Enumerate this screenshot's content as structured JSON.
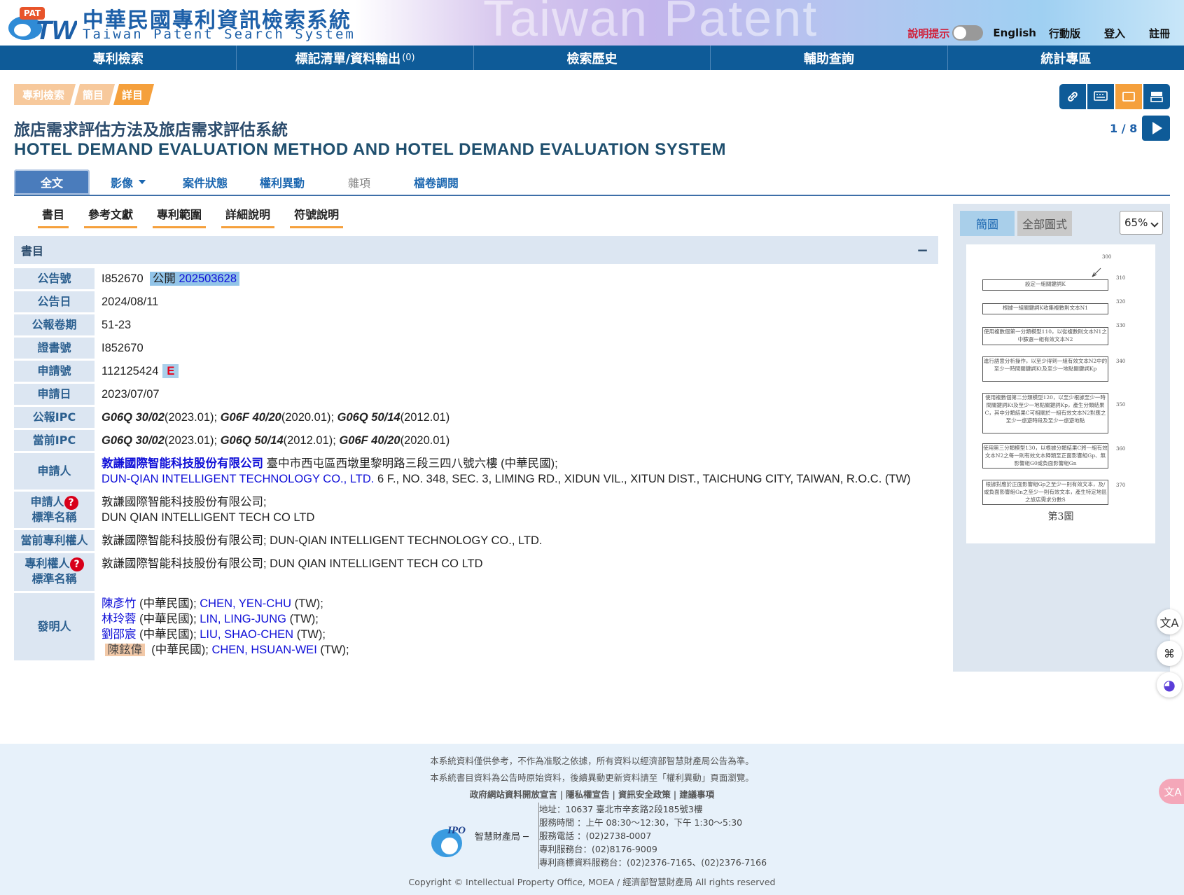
{
  "header": {
    "site_title_zh": "中華民國專利資訊檢索系統",
    "site_title_en": "Taiwan Patent Search System",
    "logo_text": "PAT",
    "logo_letters": "TW",
    "watermark": "Taiwan Patent",
    "hint_label": "說明提示",
    "links": [
      "English",
      "行動版",
      "登入",
      "註冊"
    ]
  },
  "nav": {
    "items": [
      "專利檢索",
      "標記清單/資料輸出",
      "檢索歷史",
      "輔助查詢",
      "統計專區"
    ],
    "marked_count": "(0)"
  },
  "breadcrumb": [
    "專利檢索",
    "簡目",
    "詳目"
  ],
  "pager": "1 / 8",
  "title_zh": "旅店需求評估方法及旅店需求評估系統",
  "title_en": "HOTEL DEMAND EVALUATION METHOD AND HOTEL DEMAND EVALUATION SYSTEM",
  "tabs": [
    "全文",
    "影像",
    "案件狀態",
    "權利異動",
    "雜項",
    "檔卷調閱"
  ],
  "subtabs": [
    "書目",
    "參考文獻",
    "專利範圍",
    "詳細說明",
    "符號說明"
  ],
  "section_title": "書目",
  "section_toggle": "−",
  "biblio": {
    "labels": {
      "pub_no": "公告號",
      "pub_date": "公告日",
      "gazette": "公報卷期",
      "cert_no": "證書號",
      "app_no": "申請號",
      "app_date": "申請日",
      "gazette_ipc": "公報IPC",
      "current_ipc": "當前IPC",
      "applicant": "申請人",
      "applicant_std_1": "申請人",
      "applicant_std_2": "標準名稱",
      "current_owner": "當前專利權人",
      "owner_std_1": "專利權人",
      "owner_std_2": "標準名稱",
      "inventor": "發明人"
    },
    "pub_no": "I852670",
    "pub_open_label": "公開",
    "pub_open_no": "202503628",
    "pub_date": "2024/08/11",
    "gazette": "51-23",
    "cert_no": "I852670",
    "app_no": "112125424",
    "app_badge": "E",
    "app_date": "2023/07/07",
    "gazette_ipc": [
      {
        "code": "G06Q 30/02",
        "ver": "(2023.01)"
      },
      {
        "code": "G06F 40/20",
        "ver": "(2020.01)"
      },
      {
        "code": "G06Q 50/14",
        "ver": "(2012.01)"
      }
    ],
    "current_ipc": [
      {
        "code": "G06Q 30/02",
        "ver": "(2023.01)"
      },
      {
        "code": "G06Q 50/14",
        "ver": "(2012.01)"
      },
      {
        "code": "G06F 40/20",
        "ver": "(2020.01)"
      }
    ],
    "applicant_zh": "敦謙國際智能科技股份有限公司",
    "applicant_zh_addr": "臺中市西屯區西墩里黎明路三段三四八號六樓 (中華民國);",
    "applicant_en": "DUN-QIAN INTELLIGENT TECHNOLOGY CO., LTD.",
    "applicant_en_addr": "6 F., NO. 348, SEC. 3, LIMING RD., XIDUN VIL., XITUN DIST., TAICHUNG CITY, TAIWAN, R.O.C. (TW)",
    "applicant_std_zh": "敦謙國際智能科技股份有限公司;",
    "applicant_std_en": "DUN QIAN INTELLIGENT TECH CO LTD",
    "current_owner": "敦謙國際智能科技股份有限公司; DUN-QIAN INTELLIGENT TECHNOLOGY CO., LTD.",
    "owner_std": "敦謙國際智能科技股份有限公司; DUN QIAN INTELLIGENT TECH CO LTD",
    "inventors": [
      {
        "zh": "陳彥竹",
        "country": " (中華民國); ",
        "en": "CHEN, YEN-CHU",
        "tail": " (TW);"
      },
      {
        "zh": "林玲蓉",
        "country": " (中華民國); ",
        "en": "LIN, LING-JUNG",
        "tail": " (TW);"
      },
      {
        "zh": "劉邵宸",
        "country": " (中華民國); ",
        "en": "LIU, SHAO-CHEN",
        "tail": " (TW);"
      },
      {
        "zh": "陳鉉偉",
        "country": " (中華民國); ",
        "en": "CHEN, HSUAN-WEI",
        "tail": " (TW);"
      }
    ]
  },
  "panel": {
    "btn_brief": "簡圖",
    "btn_all": "全部圖式",
    "zoom": "65%",
    "figure": {
      "ref": "300",
      "caption": "第3圖",
      "steps": [
        {
          "num": "310",
          "text": "設定一組關鍵詞K"
        },
        {
          "num": "320",
          "text": "根據一組關鍵詞K收集複數則文本N1"
        },
        {
          "num": "330",
          "text": "使用複數個第一分類模型110，以從複數則文本N1之中篩選一組有效文本N2"
        },
        {
          "num": "340",
          "text": "進行語意分析操作，以至少得到一組有效文本N2中的至少一時間關鍵詞Kt及至少一地點關鍵詞Kp"
        },
        {
          "num": "350",
          "text": "使用複數個第二分類模型120，以至少根據至少一時間關鍵詞Kt及至少一地點關鍵詞Kp，產生分類結果C，其中分類結果C可相關於一組有效文本N2對應之至少一旅遊時段及至少一旅遊地點"
        },
        {
          "num": "360",
          "text": "使用第三分類模型130，以根據分類結果C將一組有效文本N2之每一則有效文本歸類至正面影響組Gp、無影響組G0或負面影響組Gn"
        },
        {
          "num": "370",
          "text": "根據對應於正面影響組Gp之至少一則有效文本，及/或負面影響組Gn之至少一則有效文本，產生特定地區之旅店需求分數S"
        }
      ]
    }
  },
  "floating": {
    "translate": "文A",
    "apps": "⌘",
    "assistant": "◕",
    "translate2": "文A"
  },
  "footer": {
    "line1": "本系統資料僅供參考，不作為准駁之依據，所有資料以經濟部智慧財產局公告為準。",
    "line2": "本系統書目資料為公告時原始資料，後續異動更新資料請至「權利異動」頁面瀏覽。",
    "links": [
      "政府網站資料開放宣言",
      "隱私權宣告",
      "資訊安全政策",
      "建議事項"
    ],
    "ipo_name": "智慧財產局",
    "ipo_logo": "IPO",
    "address": [
      "地址：10637 臺北市辛亥路2段185號3樓",
      "服務時間 ：上午 08:30～12:30，下午 1:30～5:30",
      "服務電話 ：(02)2738-0007",
      "專利服務台：(02)8176-9009",
      "專利商標資料服務台：(02)2376-7165、(02)2376-7166"
    ],
    "copyright": "Copyright © Intellectual Property Office, MOEA / 經濟部智慧財產局 All rights reserved"
  },
  "colors": {
    "nav": "#0e5b98",
    "accent": "#f5a03c",
    "label_bg": "#dce6f2",
    "link": "#1010d8",
    "footer_bg": "#e7f1fa"
  }
}
